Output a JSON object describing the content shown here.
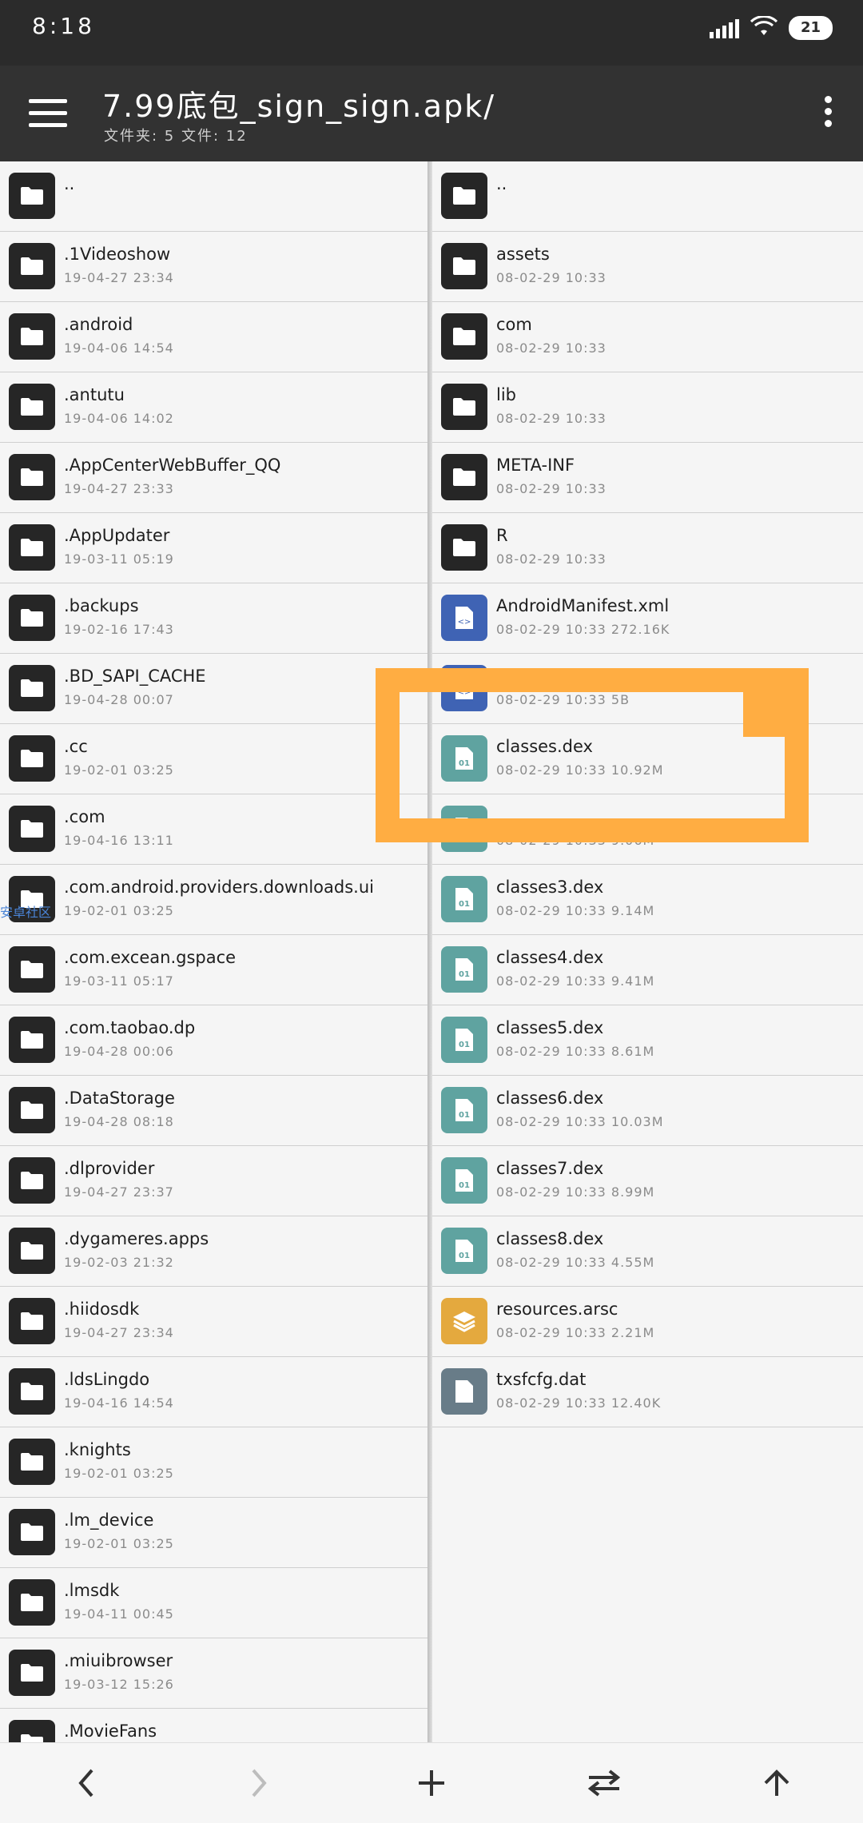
{
  "status_bar": {
    "time": "8:18",
    "battery": "21"
  },
  "toolbar": {
    "title": "7.99底包_sign_sign.apk/",
    "subtitle": "文件夹: 5  文件: 12"
  },
  "left_pane": {
    "items": [
      {
        "name": "..",
        "meta": "",
        "type": "folder"
      },
      {
        "name": ".1Videoshow",
        "meta": "19-04-27 23:34",
        "type": "folder"
      },
      {
        "name": ".android",
        "meta": "19-04-06 14:54",
        "type": "folder"
      },
      {
        "name": ".antutu",
        "meta": "19-04-06 14:02",
        "type": "folder"
      },
      {
        "name": ".AppCenterWebBuffer_QQ",
        "meta": "19-04-27 23:33",
        "type": "folder"
      },
      {
        "name": ".AppUpdater",
        "meta": "19-03-11 05:19",
        "type": "folder"
      },
      {
        "name": ".backups",
        "meta": "19-02-16 17:43",
        "type": "folder"
      },
      {
        "name": ".BD_SAPI_CACHE",
        "meta": "19-04-28 00:07",
        "type": "folder"
      },
      {
        "name": ".cc",
        "meta": "19-02-01 03:25",
        "type": "folder"
      },
      {
        "name": ".com",
        "meta": "19-04-16 13:11",
        "type": "folder"
      },
      {
        "name": ".com.android.providers.downloads.ui",
        "meta": "19-02-01 03:25",
        "type": "folder"
      },
      {
        "name": ".com.excean.gspace",
        "meta": "19-03-11 05:17",
        "type": "folder"
      },
      {
        "name": ".com.taobao.dp",
        "meta": "19-04-28 00:06",
        "type": "folder"
      },
      {
        "name": ".DataStorage",
        "meta": "19-04-28 08:18",
        "type": "folder"
      },
      {
        "name": ".dlprovider",
        "meta": "19-04-27 23:37",
        "type": "folder"
      },
      {
        "name": ".dygameres.apps",
        "meta": "19-02-03 21:32",
        "type": "folder"
      },
      {
        "name": ".hiidosdk",
        "meta": "19-04-27 23:34",
        "type": "folder"
      },
      {
        "name": ".ldsLingdo",
        "meta": "19-04-16 14:54",
        "type": "folder"
      },
      {
        "name": ".knights",
        "meta": "19-02-01 03:25",
        "type": "folder"
      },
      {
        "name": ".lm_device",
        "meta": "19-02-01 03:25",
        "type": "folder"
      },
      {
        "name": ".lmsdk",
        "meta": "19-04-11 00:45",
        "type": "folder"
      },
      {
        "name": ".miuibrowser",
        "meta": "19-03-12 15:26",
        "type": "folder"
      },
      {
        "name": ".MovieFans",
        "meta": "",
        "type": "folder"
      }
    ]
  },
  "right_pane": {
    "items": [
      {
        "name": "..",
        "meta": "",
        "type": "folder"
      },
      {
        "name": "assets",
        "meta": "08-02-29 10:33",
        "type": "folder"
      },
      {
        "name": "com",
        "meta": "08-02-29 10:33",
        "type": "folder"
      },
      {
        "name": "lib",
        "meta": "08-02-29 10:33",
        "type": "folder"
      },
      {
        "name": "META-INF",
        "meta": "08-02-29 10:33",
        "type": "folder"
      },
      {
        "name": "R",
        "meta": "08-02-29 10:33",
        "type": "folder"
      },
      {
        "name": "AndroidManifest.xml",
        "meta": "08-02-29 10:33  272.16K",
        "type": "xml"
      },
      {
        "name": "",
        "meta": "08-02-29 10:33  5B",
        "type": "xml"
      },
      {
        "name": "classes.dex",
        "meta": "08-02-29 10:33  10.92M",
        "type": "dex"
      },
      {
        "name": "",
        "meta": "08-02-29 10:33  9.06M",
        "type": "dex"
      },
      {
        "name": "classes3.dex",
        "meta": "08-02-29 10:33  9.14M",
        "type": "dex"
      },
      {
        "name": "classes4.dex",
        "meta": "08-02-29 10:33  9.41M",
        "type": "dex"
      },
      {
        "name": "classes5.dex",
        "meta": "08-02-29 10:33  8.61M",
        "type": "dex"
      },
      {
        "name": "classes6.dex",
        "meta": "08-02-29 10:33  10.03M",
        "type": "dex"
      },
      {
        "name": "classes7.dex",
        "meta": "08-02-29 10:33  8.99M",
        "type": "dex"
      },
      {
        "name": "classes8.dex",
        "meta": "08-02-29 10:33  4.55M",
        "type": "dex"
      },
      {
        "name": "resources.arsc",
        "meta": "08-02-29 10:33  2.21M",
        "type": "arsc"
      },
      {
        "name": "txsfcfg.dat",
        "meta": "08-02-29 10:33  12.40K",
        "type": "dat"
      }
    ]
  },
  "watermark": "安卓社区",
  "icons": {
    "menu": "hamburger-menu-icon",
    "more": "more-vert-icon",
    "back": "chevron-left-icon",
    "forward": "chevron-right-icon",
    "add": "plus-icon",
    "swap": "swap-icon",
    "up": "arrow-up-icon"
  },
  "colors": {
    "toolbar": "#323232",
    "folder": "#262626",
    "xml": "#3f63b4",
    "dex": "#5fa3a0",
    "arsc": "#e4a93e",
    "dat": "#687c88",
    "highlight": "#ffad42"
  }
}
